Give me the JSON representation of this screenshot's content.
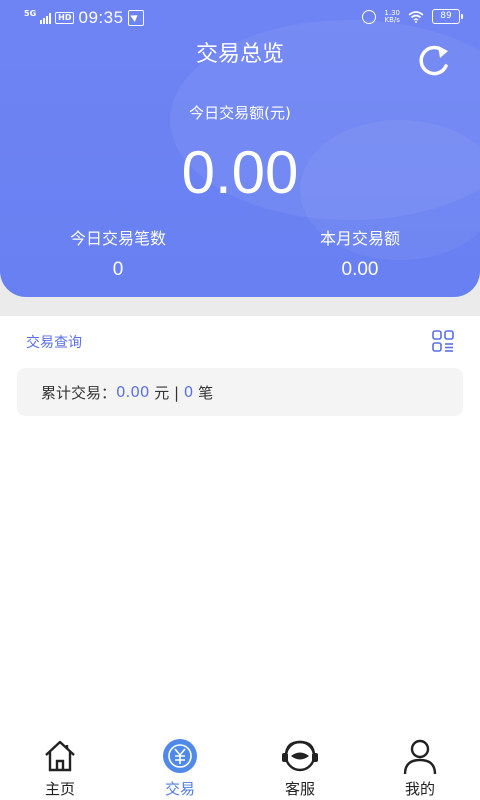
{
  "status_bar": {
    "network": "5G",
    "hd": "HD",
    "time": "09:35",
    "speed_top": "1.30",
    "speed_unit": "KB/s",
    "battery": "89"
  },
  "header": {
    "title": "交易总览",
    "today_label": "今日交易额(元)",
    "today_amount": "0.00",
    "today_count_label": "今日交易笔数",
    "today_count_value": "0",
    "month_amount_label": "本月交易额",
    "month_amount_value": "0.00"
  },
  "query": {
    "label": "交易查询"
  },
  "summary": {
    "prefix": "累计交易：",
    "amount": "0.00",
    "amount_unit": " 元 | ",
    "count": "0",
    "count_unit": " 笔"
  },
  "nav": {
    "items": [
      {
        "label": "主页",
        "icon": "home-icon"
      },
      {
        "label": "交易",
        "icon": "yuan-icon",
        "active": true
      },
      {
        "label": "客服",
        "icon": "customer-service-icon"
      },
      {
        "label": "我的",
        "icon": "user-icon"
      }
    ]
  },
  "colors": {
    "header": "#6f84f4",
    "accent": "#5a73e6",
    "nav_active": "#4f7be6"
  }
}
